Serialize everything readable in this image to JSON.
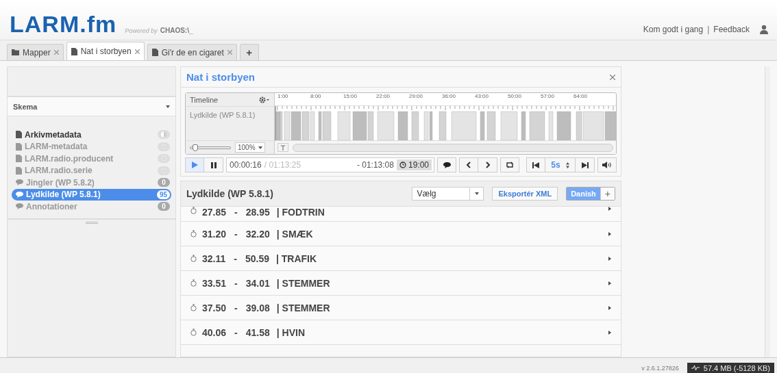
{
  "header": {
    "logo": "LARM.fm",
    "powered_by": "Powered by",
    "powered_brand": "CHAOS:\\_",
    "links": [
      {
        "label": "Kom godt i gang"
      },
      {
        "label": "Feedback"
      }
    ],
    "separator": "|"
  },
  "tabs": [
    {
      "label": "Mapper",
      "kind": "folder",
      "selected": false
    },
    {
      "label": "Nat i storbyen",
      "kind": "document",
      "selected": true
    },
    {
      "label": "Gi'r de en cigaret",
      "kind": "document",
      "selected": false
    }
  ],
  "add_tab": "+",
  "sidebar": {
    "dropdown": "Skema",
    "items": [
      {
        "label": "Arkivmetadata",
        "kind": "document",
        "muted": false,
        "selected": false,
        "badge": {
          "kind": "half"
        }
      },
      {
        "label": "LARM-metadata",
        "kind": "document",
        "muted": true,
        "selected": false,
        "badge": {
          "kind": "empty"
        }
      },
      {
        "label": "LARM.radio.producent",
        "kind": "document",
        "muted": true,
        "selected": false,
        "badge": {
          "kind": "empty"
        }
      },
      {
        "label": "LARM.radio.serie",
        "kind": "document",
        "muted": true,
        "selected": false,
        "badge": {
          "kind": "empty"
        }
      },
      {
        "label": "Jingler (WP 5.8.2)",
        "kind": "comment",
        "muted": true,
        "selected": false,
        "badge": {
          "kind": "count",
          "text": "0"
        }
      },
      {
        "label": "Lydkilde (WP 5.8.1)",
        "kind": "comment",
        "muted": false,
        "selected": true,
        "badge": {
          "kind": "count",
          "text": "95"
        }
      },
      {
        "label": "Annotationer",
        "kind": "comment",
        "muted": true,
        "selected": false,
        "badge": {
          "kind": "count",
          "text": "0"
        }
      }
    ]
  },
  "player": {
    "title": "Nat i storbyen",
    "timeline_label": "Timeline",
    "track": "Lydkilde (WP 5.8.1)",
    "ticks": [
      "1:00",
      "8:00",
      "15:00",
      "22:00",
      "29:00",
      "36:00",
      "43:00",
      "50:00",
      "57:00",
      "64:00"
    ],
    "zoom": "100%",
    "zoom_slider": {
      "level": 0.05
    },
    "position": "00:00:16",
    "separator": "/",
    "duration": "01:13:25",
    "remaining": "- 01:13:08",
    "clock": "19:00",
    "step": "5s"
  },
  "annotations": {
    "title": "Lydkilde (WP 5.8.1)",
    "select": "Vælg",
    "export": "Eksportér XML",
    "language": "Danish",
    "add": "+",
    "rows": [
      {
        "start": "27.85",
        "dash": "-",
        "end": "28.95",
        "label": "| FODTRIN"
      },
      {
        "start": "31.20",
        "dash": "-",
        "end": "32.20",
        "label": "| SMÆK"
      },
      {
        "start": "32.11",
        "dash": "-",
        "end": "50.59",
        "label": "| TRAFIK"
      },
      {
        "start": "33.51",
        "dash": "-",
        "end": "34.01",
        "label": "| STEMMER"
      },
      {
        "start": "37.50",
        "dash": "-",
        "end": "39.08",
        "label": "| STEMMER"
      },
      {
        "start": "40.06",
        "dash": "-",
        "end": "41.58",
        "label": "| HVIN"
      }
    ]
  },
  "footer": {
    "version": "v 2.6.1.27826",
    "memory": "57.4 MB (-5128 KB)"
  }
}
